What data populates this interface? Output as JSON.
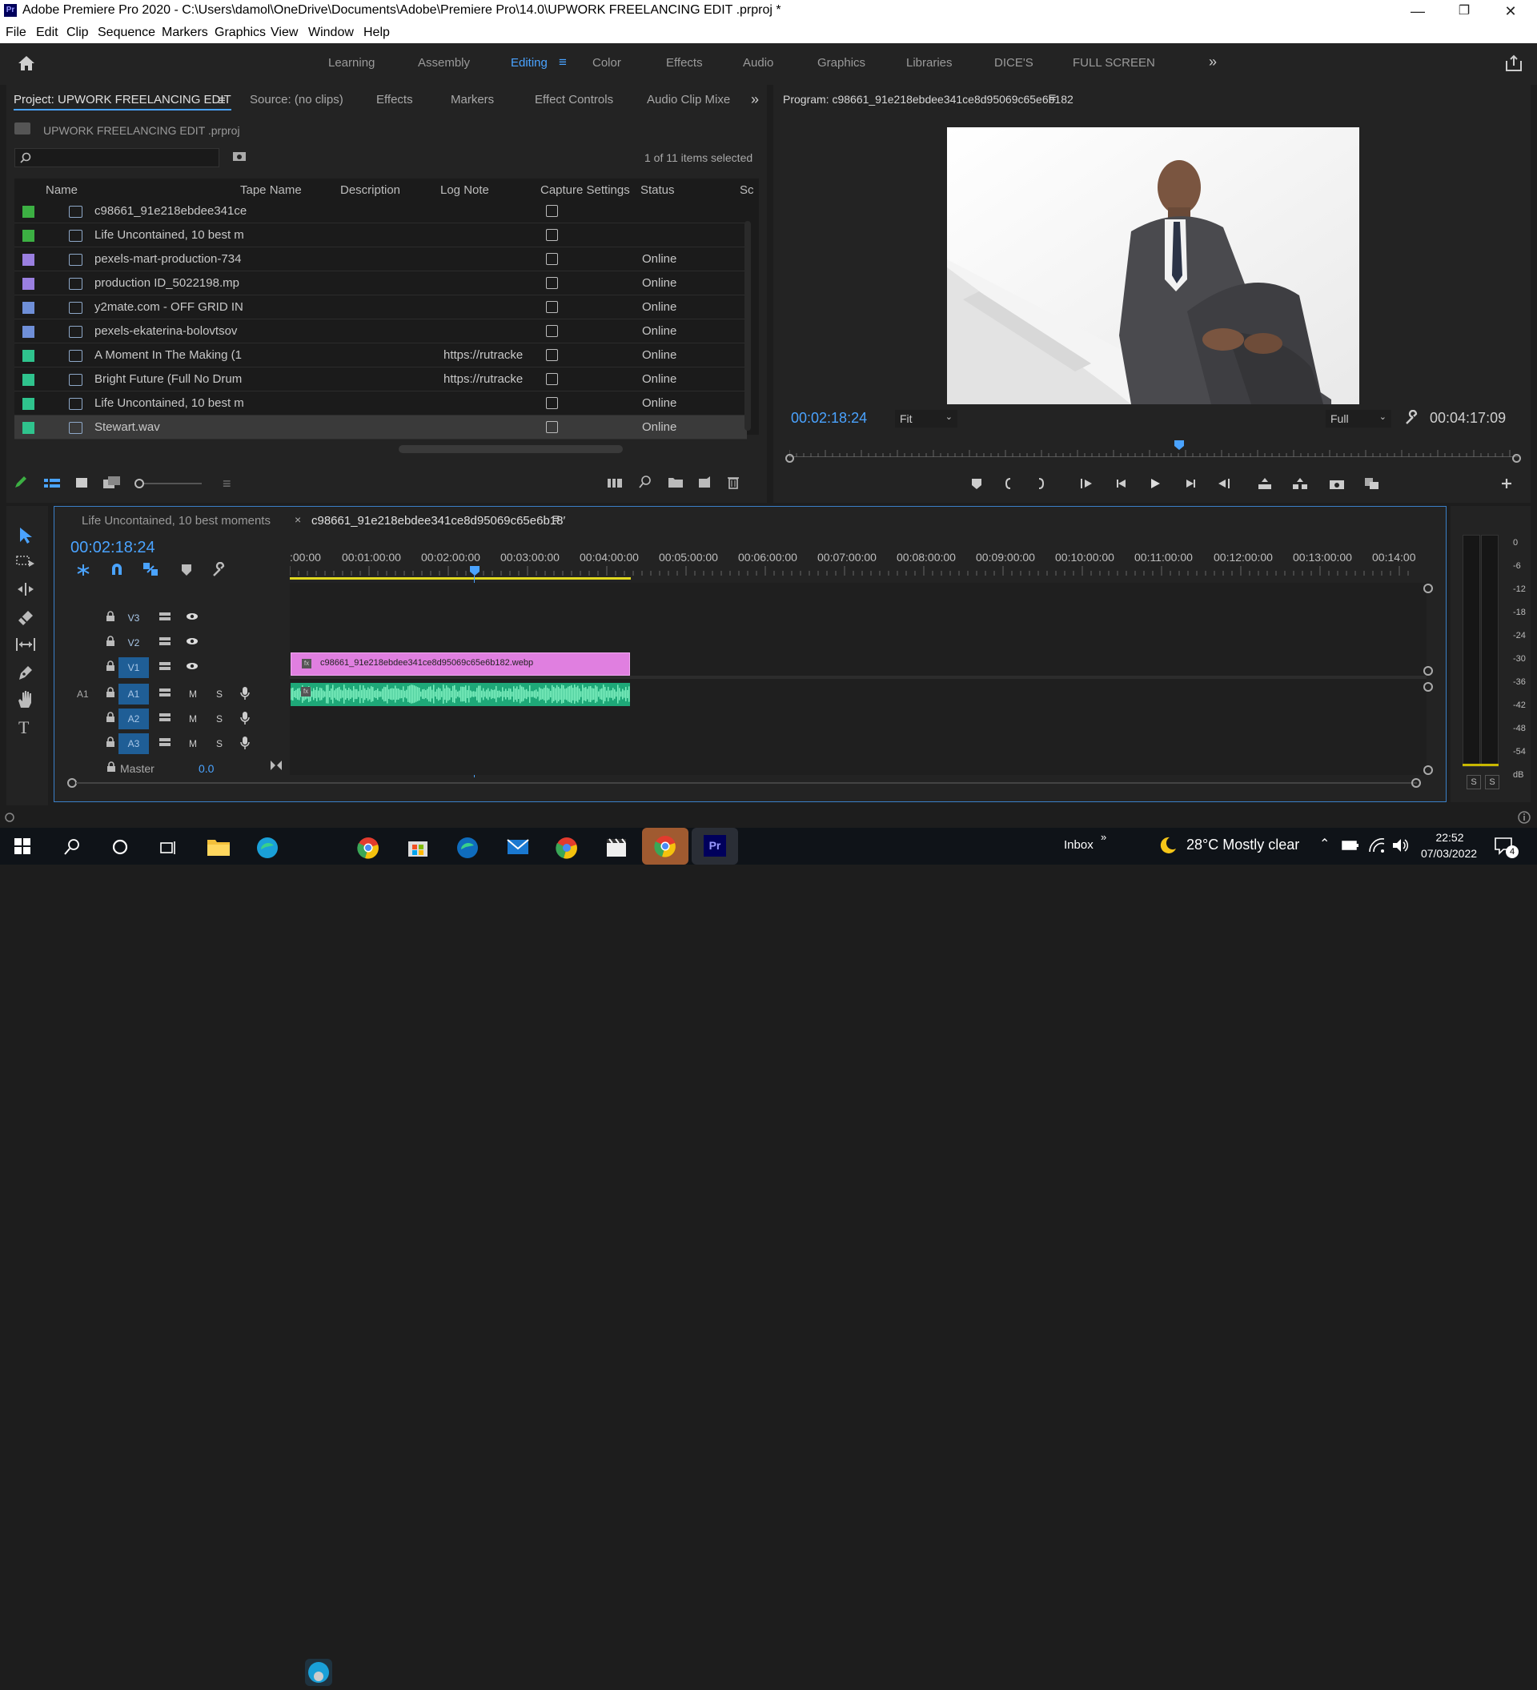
{
  "window": {
    "app_title": "Adobe Premiere Pro 2020 - C:\\Users\\damol\\OneDrive\\Documents\\Adobe\\Premiere Pro\\14.0\\UPWORK FREELANCING EDIT .prproj *",
    "logo_text": "Pr"
  },
  "menu": [
    "File",
    "Edit",
    "Clip",
    "Sequence",
    "Markers",
    "Graphics",
    "View",
    "Window",
    "Help"
  ],
  "workspaces": [
    "Learning",
    "Assembly",
    "Editing",
    "Color",
    "Effects",
    "Audio",
    "Graphics",
    "Libraries",
    "DICE'S",
    "FULL SCREEN"
  ],
  "project_panel": {
    "tabs": [
      "Project: UPWORK FREELANCING EDIT",
      "Source: (no clips)",
      "Effects",
      "Markers",
      "Effect Controls",
      "Audio Clip Mixe"
    ],
    "project_file": "UPWORK FREELANCING EDIT .prproj",
    "items_selected": "1 of 11 items selected",
    "columns": [
      "Name",
      "Tape Name",
      "Description",
      "Log Note",
      "Capture Settings",
      "Status",
      "Sc"
    ],
    "items": [
      {
        "name": "c98661_91e218ebdee341ce",
        "log_note": "",
        "status": "",
        "color": "#3cb043"
      },
      {
        "name": "Life Uncontained, 10 best m",
        "log_note": "",
        "status": "",
        "color": "#3cb043"
      },
      {
        "name": "pexels-mart-production-734",
        "log_note": "",
        "status": "Online",
        "color": "#9a7fe0"
      },
      {
        "name": "production ID_5022198.mp",
        "log_note": "",
        "status": "Online",
        "color": "#9a7fe0"
      },
      {
        "name": "y2mate.com - OFF GRID IN",
        "log_note": "",
        "status": "Online",
        "color": "#6f8fd8"
      },
      {
        "name": "pexels-ekaterina-bolovtsov",
        "log_note": "",
        "status": "Online",
        "color": "#6f8fd8"
      },
      {
        "name": "A Moment In The Making (1",
        "log_note": "https://rutracke",
        "status": "Online",
        "color": "#2fc38d"
      },
      {
        "name": "Bright Future (Full No Drum",
        "log_note": "https://rutracke",
        "status": "Online",
        "color": "#2fc38d"
      },
      {
        "name": "Life Uncontained, 10 best m",
        "log_note": "",
        "status": "Online",
        "color": "#2fc38d"
      },
      {
        "name": "Stewart.wav",
        "log_note": "",
        "status": "Online",
        "color": "#2fc38d"
      }
    ]
  },
  "program_monitor": {
    "title": "Program: c98661_91e218ebdee341ce8d95069c65e6b182",
    "timecode": "00:02:18:24",
    "fit": "Fit",
    "resolution": "Full",
    "duration": "00:04:17:09"
  },
  "timeline": {
    "tabs": [
      "Life Uncontained, 10 best moments",
      "c98661_91e218ebdee341ce8d95069c65e6b18′"
    ],
    "timecode": "00:02:18:24",
    "ruler": [
      ":00:00",
      "00:01:00:00",
      "00:02:00:00",
      "00:03:00:00",
      "00:04:00:00",
      "00:05:00:00",
      "00:06:00:00",
      "00:07:00:00",
      "00:08:00:00",
      "00:09:00:00",
      "00:10:00:00",
      "00:11:00:00",
      "00:12:00:00",
      "00:13:00:00",
      "00:14:00"
    ],
    "video_tracks": [
      "V3",
      "V2",
      "V1"
    ],
    "audio_tracks": [
      "A1",
      "A2",
      "A3"
    ],
    "source_patch": {
      "video": "V1",
      "audio": "A1"
    },
    "master_label": "Master",
    "master_value": "0.0",
    "clip_name": "c98661_91e218ebdee341ce8d95069c65e6b182.webp",
    "track_btn_m": "M",
    "track_btn_s": "S"
  },
  "audio_meter": {
    "scale": [
      "0",
      "-6",
      "-12",
      "-18",
      "-24",
      "-30",
      "-36",
      "-42",
      "-48",
      "-54",
      "dB"
    ],
    "buttons": [
      "S",
      "S"
    ]
  },
  "taskbar": {
    "inbox": "Inbox",
    "weather": "28°C  Mostly clear",
    "time": "22:52",
    "date": "07/03/2022",
    "notifications": "4"
  }
}
